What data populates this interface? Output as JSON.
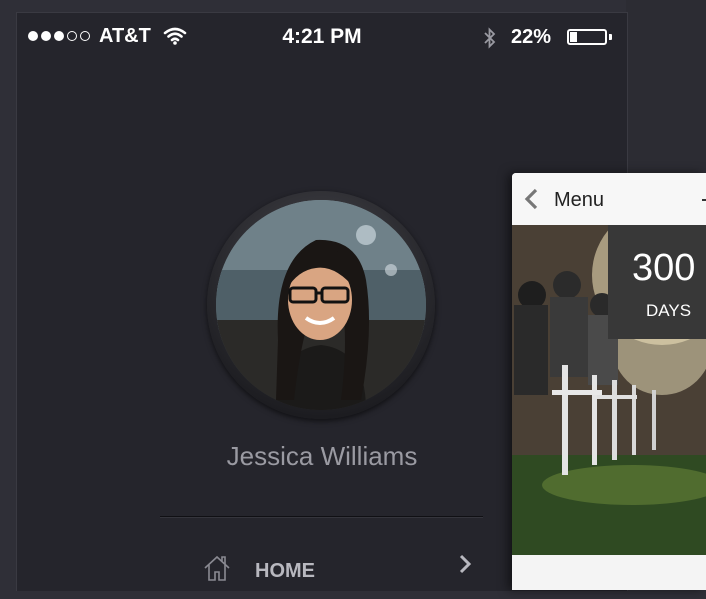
{
  "status_bar": {
    "signal_bars_filled": 3,
    "signal_bars_total": 5,
    "carrier": "AT&T",
    "time": "4:21 PM",
    "battery_percent": "22%",
    "battery_level": 0.22,
    "icons": [
      "wifi-icon",
      "bluetooth-icon",
      "battery-icon"
    ]
  },
  "profile": {
    "name": "Jessica Williams",
    "avatar_icon": "profile-photo"
  },
  "menu": {
    "items": [
      {
        "label": "HOME",
        "icon": "home-icon",
        "chevron": "chevron-right-icon"
      }
    ]
  },
  "overlay_card": {
    "back_label": "Menu",
    "back_icon": "chevron-left-icon",
    "counter_value": "300",
    "counter_unit": "DAYS"
  },
  "colors": {
    "background": "#25252c",
    "text_muted": "#9a9aa2",
    "accent_white": "#ffffff"
  }
}
